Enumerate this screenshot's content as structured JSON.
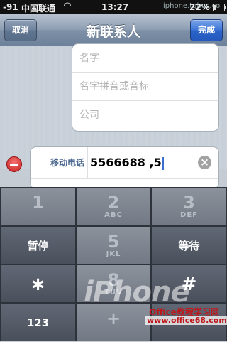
{
  "status_bar": {
    "signal": "-91",
    "carrier": "中国联通",
    "time": "13:27",
    "watermark_text": "iphone.tgbus.co",
    "battery": "22%"
  },
  "navbar": {
    "title": "新联系人",
    "cancel_label": "取消",
    "done_label": "完成"
  },
  "form": {
    "fields": [
      {
        "placeholder": "名字"
      },
      {
        "placeholder": "名字拼音或音标"
      },
      {
        "placeholder": "公司"
      }
    ],
    "phone": {
      "label": "移动电话",
      "value": "5566688 ,5"
    }
  },
  "keypad": {
    "keys": [
      {
        "digit": "1",
        "letters": ""
      },
      {
        "digit": "2",
        "letters": "ABC"
      },
      {
        "digit": "3",
        "letters": "DEF"
      },
      {
        "label": "暂停"
      },
      {
        "digit": "5",
        "letters": "JKL"
      },
      {
        "label": "等待"
      },
      {
        "symbol": "∗"
      },
      {
        "digit": "8",
        "letters": "TUV"
      },
      {
        "symbol": "#"
      },
      {
        "label": "123"
      },
      {
        "symbol": "+"
      }
    ]
  },
  "watermarks": {
    "big": "iPhone",
    "office_site": "Office教程学习网",
    "url": "www.office68.com"
  },
  "colors": {
    "navbar": "#8d9db2",
    "done_button": "#2b63c9",
    "label_blue": "#4a6790",
    "delete_red": "#c81f1f"
  }
}
